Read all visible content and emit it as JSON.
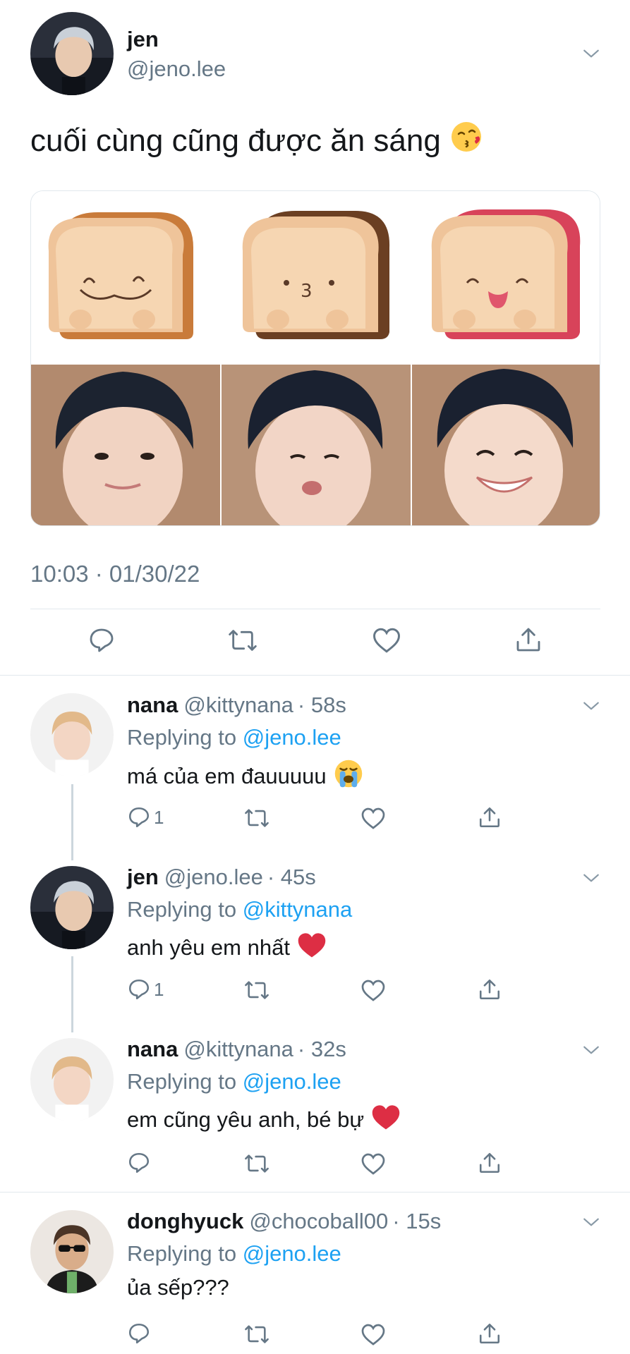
{
  "main_tweet": {
    "name": "jen",
    "handle": "@jeno.lee",
    "text": "cuối cùng cũng được ăn sáng",
    "emoji": "kissing-face-emoji",
    "timestamp": "10:03 · 01/30/22",
    "media": [
      {
        "kind": "toast-plush",
        "face": "wobbly smile"
      },
      {
        "kind": "toast-plush",
        "face": "pout"
      },
      {
        "kind": "toast-plush",
        "face": "wink tongue"
      },
      {
        "kind": "photo",
        "face": "smile"
      },
      {
        "kind": "photo",
        "face": "pout"
      },
      {
        "kind": "photo",
        "face": "grin"
      }
    ]
  },
  "replies": [
    {
      "name": "nana",
      "handle": "@kittynana",
      "time": "· 58s",
      "replying_prefix": "Replying to ",
      "replying_to": "@jeno.lee",
      "text": "má của em đauuuuu",
      "emoji": "crying-face-emoji",
      "reply_count": "1"
    },
    {
      "name": "jen",
      "handle": "@jeno.lee",
      "time": "· 45s",
      "replying_prefix": "Replying to ",
      "replying_to": "@kittynana",
      "text": "anh yêu em nhất",
      "emoji": "red-heart-emoji",
      "reply_count": "1"
    },
    {
      "name": "nana",
      "handle": "@kittynana",
      "time": "· 32s",
      "replying_prefix": "Replying to ",
      "replying_to": "@jeno.lee",
      "text": "em cũng yêu anh, bé bự",
      "emoji": "red-heart-emoji",
      "reply_count": ""
    },
    {
      "name": "donghyuck",
      "handle": "@chocoball00",
      "time": "· 15s",
      "replying_prefix": "Replying to ",
      "replying_to": "@jeno.lee",
      "text": "ủa sếp???",
      "emoji": "",
      "reply_count": ""
    }
  ],
  "colors": {
    "text": "#14171a",
    "secondary": "#657786",
    "link": "#1da1f2",
    "divider": "#e1e8ed",
    "heart": "#e0245e"
  }
}
